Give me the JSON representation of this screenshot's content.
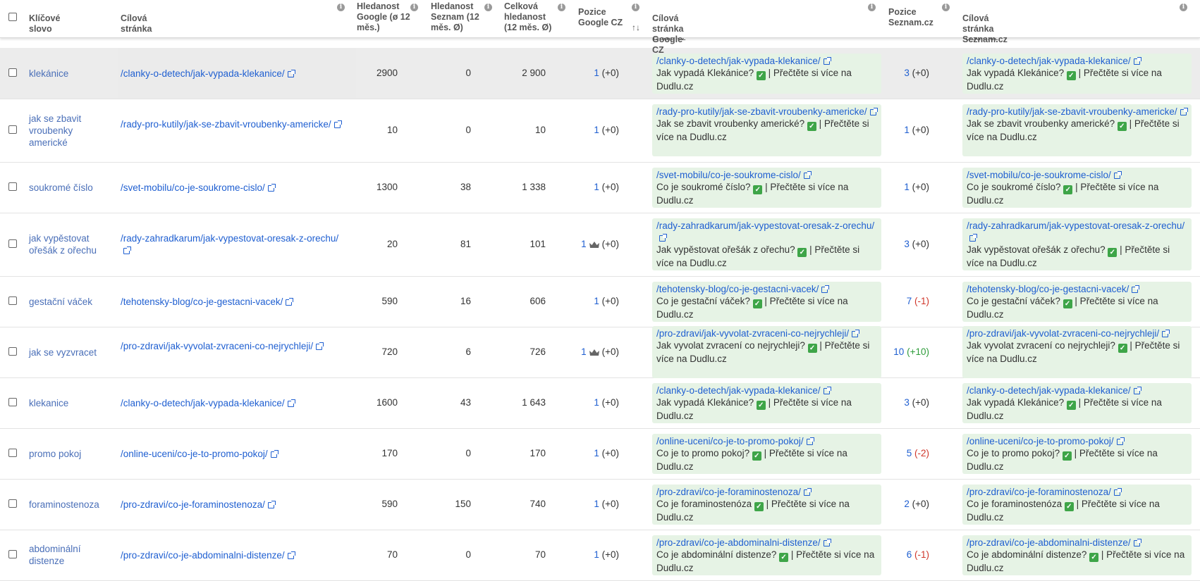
{
  "header": {
    "keyword": "Klíčové slovo",
    "target_page": "Cílová stránka",
    "search_google": "Hledanost Google (ø 12 měs.)",
    "search_seznam": "Hledanost Seznam (12 měs. Ø)",
    "search_total": "Celková hledanost (12 měs. Ø)",
    "pos_google": "Pozice Google CZ",
    "sort_arrow": "↑↓",
    "target_google": "Cílová stránka Google CZ",
    "pos_seznam": "Pozice Seznam.cz",
    "target_seznam": "Cílová stránka Seznam.cz",
    "peek_text": "Dudlu.cz"
  },
  "icons": {
    "info": "info-icon",
    "external": "external-link-icon",
    "check": "check-icon",
    "crown": "crown-icon"
  },
  "colors": {
    "link": "#1f5fd1",
    "keyword": "#4a6fb8",
    "green_box": "#e6f3e5",
    "up": "#2e9c3a",
    "down": "#d0362a",
    "check": "#3ea548"
  },
  "rows": [
    {
      "keyword": "klekánice",
      "url": "/clanky-o-detech/jak-vypada-klekanice/",
      "google": "2900",
      "seznam": "0",
      "total": "2 900",
      "gpos": "1",
      "gdelta": "(+0)",
      "crown": false,
      "gurl": "/clanky-o-detech/jak-vypada-klekanice/",
      "gtitle_a": "Jak vypadá Klekánice?",
      "gtitle_b": "| Přečtěte si více na Dudlu.cz",
      "spos": "3",
      "sdelta": "(+0)",
      "surl": "/clanky-o-detech/jak-vypada-klekanice/",
      "stitle_a": "Jak vypadá Klekánice?",
      "stitle_b": "| Přečtěte si více na Dudlu.cz"
    },
    {
      "keyword": "jak se zbavit vroubenky americké",
      "url": "/rady-pro-kutily/jak-se-zbavit-vroubenky-americke/",
      "google": "10",
      "seznam": "0",
      "total": "10",
      "gpos": "1",
      "gdelta": "(+0)",
      "crown": false,
      "gurl": "/rady-pro-kutily/jak-se-zbavit-vroubenky-americke/",
      "gtitle_a": "Jak se zbavit vroubenky americké?",
      "gtitle_b": "| Přečtěte si více na Dudlu.cz",
      "spos": "1",
      "sdelta": "(+0)",
      "surl": "/rady-pro-kutily/jak-se-zbavit-vroubenky-americke/",
      "stitle_a": "Jak se zbavit vroubenky americké?",
      "stitle_b": "| Přečtěte si více na Dudlu.cz"
    },
    {
      "keyword": "soukromé číslo",
      "url": "/svet-mobilu/co-je-soukrome-cislo/",
      "google": "1300",
      "seznam": "38",
      "total": "1 338",
      "gpos": "1",
      "gdelta": "(+0)",
      "crown": false,
      "gurl": "/svet-mobilu/co-je-soukrome-cislo/",
      "gtitle_a": "Co je soukromé číslo?",
      "gtitle_b": "| Přečtěte si více na Dudlu.cz",
      "spos": "1",
      "sdelta": "(+0)",
      "surl": "/svet-mobilu/co-je-soukrome-cislo/",
      "stitle_a": "Co je soukromé číslo?",
      "stitle_b": "| Přečtěte si více na Dudlu.cz"
    },
    {
      "keyword": "jak vypěstovat ořešák z ořechu",
      "url": "/rady-zahradkarum/jak-vypestovat-oresak-z-orechu/",
      "google": "20",
      "seznam": "81",
      "total": "101",
      "gpos": "1",
      "gdelta": "(+0)",
      "crown": true,
      "gurl": "/rady-zahradkarum/jak-vypestovat-oresak-z-orechu/",
      "gtitle_a": "Jak vypěstovat ořešák z ořechu?",
      "gtitle_b": "| Přečtěte si více na Dudlu.cz",
      "spos": "3",
      "sdelta": "(+0)",
      "surl": "/rady-zahradkarum/jak-vypestovat-oresak-z-orechu/",
      "stitle_a": "Jak vypěstovat ořešák z ořechu?",
      "stitle_b": "| Přečtěte si více na Dudlu.cz"
    },
    {
      "keyword": "gestační váček",
      "url": "/tehotensky-blog/co-je-gestacni-vacek/",
      "google": "590",
      "seznam": "16",
      "total": "606",
      "gpos": "1",
      "gdelta": "(+0)",
      "crown": false,
      "gurl": "/tehotensky-blog/co-je-gestacni-vacek/",
      "gtitle_a": "Co je gestační váček?",
      "gtitle_b": "| Přečtěte si více na Dudlu.cz",
      "spos": "7",
      "sdelta": "(-1)",
      "surl": "/tehotensky-blog/co-je-gestacni-vacek/",
      "stitle_a": "Co je gestační váček?",
      "stitle_b": "| Přečtěte si více na Dudlu.cz"
    },
    {
      "keyword": "jak se vyzvracet",
      "url": "/pro-zdravi/jak-vyvolat-zvraceni-co-nejrychleji/",
      "google": "720",
      "seznam": "6",
      "total": "726",
      "gpos": "1",
      "gdelta": "(+0)",
      "crown": true,
      "gurl": "/pro-zdravi/jak-vyvolat-zvraceni-co-nejrychleji/",
      "gtitle_a": "Jak vyvolat zvracení co nejrychleji?",
      "gtitle_b": "| Přečtěte si více na Dudlu.cz",
      "spos": "10",
      "sdelta": "(+10)",
      "surl": "/pro-zdravi/jak-vyvolat-zvraceni-co-nejrychleji/",
      "stitle_a": "Jak vyvolat zvracení co nejrychleji?",
      "stitle_b": "| Přečtěte si více na Dudlu.cz"
    },
    {
      "keyword": "klekanice",
      "url": "/clanky-o-detech/jak-vypada-klekanice/",
      "google": "1600",
      "seznam": "43",
      "total": "1 643",
      "gpos": "1",
      "gdelta": "(+0)",
      "crown": false,
      "gurl": "/clanky-o-detech/jak-vypada-klekanice/",
      "gtitle_a": "Jak vypadá Klekánice?",
      "gtitle_b": "| Přečtěte si více na Dudlu.cz",
      "spos": "3",
      "sdelta": "(+0)",
      "surl": "/clanky-o-detech/jak-vypada-klekanice/",
      "stitle_a": "Jak vypadá Klekánice?",
      "stitle_b": "| Přečtěte si více na Dudlu.cz"
    },
    {
      "keyword": "promo pokoj",
      "url": "/online-uceni/co-je-to-promo-pokoj/",
      "google": "170",
      "seznam": "0",
      "total": "170",
      "gpos": "1",
      "gdelta": "(+0)",
      "crown": false,
      "gurl": "/online-uceni/co-je-to-promo-pokoj/",
      "gtitle_a": "Co je to promo pokoj?",
      "gtitle_b": "| Přečtěte si více na Dudlu.cz",
      "spos": "5",
      "sdelta": "(-2)",
      "surl": "/online-uceni/co-je-to-promo-pokoj/",
      "stitle_a": "Co je to promo pokoj?",
      "stitle_b": "| Přečtěte si více na Dudlu.cz"
    },
    {
      "keyword": "foraminostenoza",
      "url": "/pro-zdravi/co-je-foraminostenoza/",
      "google": "590",
      "seznam": "150",
      "total": "740",
      "gpos": "1",
      "gdelta": "(+0)",
      "crown": false,
      "gurl": "/pro-zdravi/co-je-foraminostenoza/",
      "gtitle_a": "Co je foraminostenóza",
      "gtitle_b": "| Přečtěte si více na Dudlu.cz",
      "spos": "2",
      "sdelta": "(+0)",
      "surl": "/pro-zdravi/co-je-foraminostenoza/",
      "stitle_a": "Co je foraminostenóza",
      "stitle_b": "| Přečtěte si více na Dudlu.cz"
    },
    {
      "keyword": "abdominální distenze",
      "url": "/pro-zdravi/co-je-abdominalni-distenze/",
      "google": "70",
      "seznam": "0",
      "total": "70",
      "gpos": "1",
      "gdelta": "(+0)",
      "crown": false,
      "gurl": "/pro-zdravi/co-je-abdominalni-distenze/",
      "gtitle_a": "Co je abdominální distenze?",
      "gtitle_b": "| Přečtěte si více na Dudlu.cz",
      "spos": "6",
      "sdelta": "(-1)",
      "surl": "/pro-zdravi/co-je-abdominalni-distenze/",
      "stitle_a": "Co je abdominální distenze?",
      "stitle_b": "| Přečtěte si více na Dudlu.cz"
    }
  ]
}
